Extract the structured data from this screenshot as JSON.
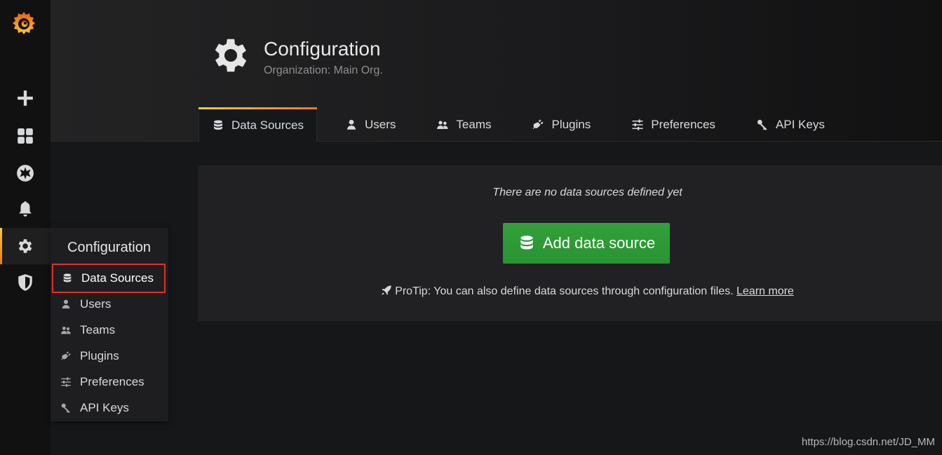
{
  "sidebar": {
    "icons": [
      "grafana-logo-icon",
      "plus-icon",
      "dashboards-icon",
      "explore-compass-icon",
      "alerting-bell-icon",
      "configuration-gear-icon",
      "server-admin-shield-icon"
    ]
  },
  "header": {
    "title": "Configuration",
    "subtitle": "Organization: Main Org."
  },
  "tabs": [
    {
      "label": "Data Sources",
      "icon": "database-icon",
      "active": true
    },
    {
      "label": "Users",
      "icon": "user-icon"
    },
    {
      "label": "Teams",
      "icon": "users-icon"
    },
    {
      "label": "Plugins",
      "icon": "plug-icon"
    },
    {
      "label": "Preferences",
      "icon": "sliders-icon"
    },
    {
      "label": "API Keys",
      "icon": "key-icon"
    }
  ],
  "main": {
    "empty_message": "There are no data sources defined yet",
    "add_button": "Add data source",
    "protip": "ProTip: You can also define data sources through configuration files.",
    "learn_more": "Learn more"
  },
  "flyout": {
    "title": "Configuration",
    "items": [
      {
        "label": "Data Sources",
        "selected": true
      },
      {
        "label": "Users"
      },
      {
        "label": "Teams"
      },
      {
        "label": "Plugins"
      },
      {
        "label": "Preferences"
      },
      {
        "label": "API Keys"
      }
    ]
  },
  "watermark": "https://blog.csdn.net/JD_MM",
  "colors": {
    "accent_start": "#f9cc3c",
    "accent_end": "#eb7b18",
    "button_green": "#299432",
    "highlight_red": "#e0302a"
  }
}
